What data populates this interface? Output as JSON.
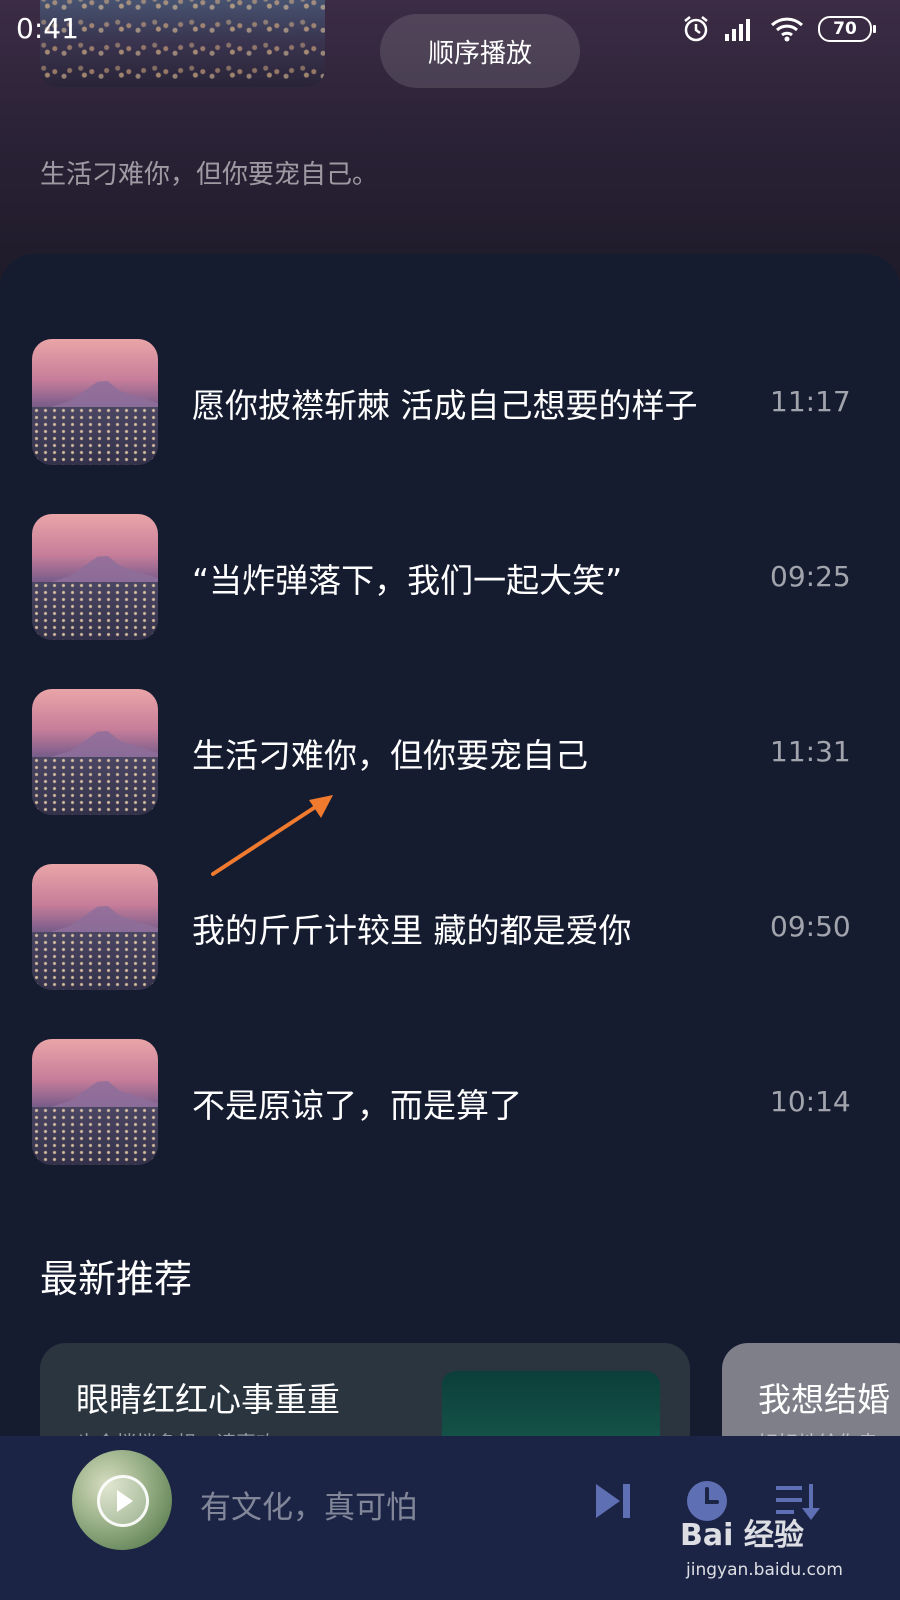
{
  "status_bar": {
    "time": "0:41",
    "battery": "70",
    "icons": [
      "alarm-icon",
      "signal-icon",
      "wifi-icon",
      "battery-icon"
    ]
  },
  "header": {
    "play_order_label": "顺序播放",
    "subtitle": "生活刁难你，但你要宠自己。"
  },
  "list": {
    "items": [
      {
        "title": "愿你披襟斩棘 活成自己想要的样子",
        "time": "11:17"
      },
      {
        "title": "“当炸弹落下，我们一起大笑”",
        "time": "09:25"
      },
      {
        "title": "生活刁难你，但你要宠自己",
        "time": "11:31"
      },
      {
        "title": "我的斤斤计较里 藏的都是爱你",
        "time": "09:50"
      },
      {
        "title": "不是原谅了，而是算了",
        "time": "10:14"
      }
    ]
  },
  "recommend": {
    "section_title": "最新推荐",
    "cards": [
      {
        "title": "眼睛红红心事重重",
        "subtitle": "也会悄悄多想，请喜欢"
      },
      {
        "title": "我想结婚",
        "subtitle": "好好地给你幸"
      }
    ]
  },
  "player": {
    "title": "有文化，真可怕",
    "controls": [
      "next-icon",
      "timer-icon",
      "playlist-icon"
    ]
  },
  "watermark": {
    "logo": "Bai 经验",
    "url": "jingyan.baidu.com"
  },
  "colors": {
    "background": "#161c30",
    "player_bar": "#1b2445",
    "accent_icon": "#5f6fb4",
    "annotation_arrow": "#f07a2e"
  }
}
